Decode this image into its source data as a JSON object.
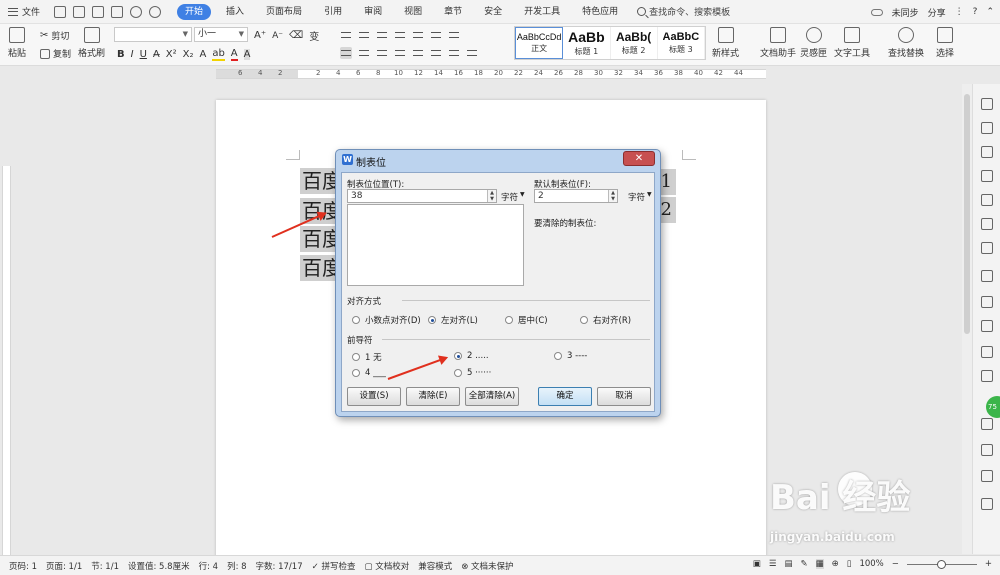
{
  "menubar": {
    "file": "文件",
    "tabs": [
      "开始",
      "插入",
      "页面布局",
      "引用",
      "审阅",
      "视图",
      "章节",
      "安全",
      "开发工具",
      "特色应用"
    ],
    "search": "查找命令、搜索模板",
    "sync": "未同步",
    "share": "分享"
  },
  "ribbon": {
    "paste": "粘贴",
    "cut": "剪切",
    "copy": "复制",
    "format_painter": "格式刷",
    "font_name": "",
    "font_size": "小一",
    "styles": [
      {
        "sample": "AaBbCcDd",
        "name": "正文"
      },
      {
        "sample": "AaBb",
        "name": "标题 1"
      },
      {
        "sample": "AaBb(",
        "name": "标题 2"
      },
      {
        "sample": "AaBbC",
        "name": "标题 3"
      }
    ],
    "new_style": "新样式",
    "doc_helper": "文档助手",
    "inspiration": "灵感匣",
    "text_tools": "文字工具",
    "find_replace": "查找替换",
    "select": "选择"
  },
  "document": {
    "lines": [
      "百度",
      "百度",
      "百度",
      "百度"
    ],
    "nums": [
      "1",
      "2"
    ]
  },
  "dialog": {
    "title": "制表位",
    "tab_pos_label": "制表位位置(T):",
    "tab_pos_value": "38",
    "unit": "字符",
    "default_label": "默认制表位(F):",
    "default_value": "2",
    "clear_label": "要清除的制表位:",
    "align_group": "对齐方式",
    "align_options": [
      "小数点对齐(D)",
      "左对齐(L)",
      "居中(C)",
      "右对齐(R)"
    ],
    "leader_group": "前导符",
    "leader_options": [
      "1 无",
      "2 .....",
      "3 ----",
      "4 ___",
      "5 ······"
    ],
    "buttons": {
      "set": "设置(S)",
      "clear": "清除(E)",
      "clear_all": "全部清除(A)",
      "ok": "确定",
      "cancel": "取消"
    }
  },
  "status": {
    "page_num": "页码: 1",
    "pages": "页面: 1/1",
    "section": "节: 1/1",
    "setting": "设置值: 5.8厘米",
    "row": "行: 4",
    "col": "列: 8",
    "words": "字数: 17/17",
    "spell": "拼写检查",
    "proof": "文档校对",
    "compat": "兼容模式",
    "protect": "文档未保护",
    "zoom": "100%"
  },
  "watermark": {
    "brand": "Bai  经验",
    "url": "jingyan.baidu.com"
  }
}
